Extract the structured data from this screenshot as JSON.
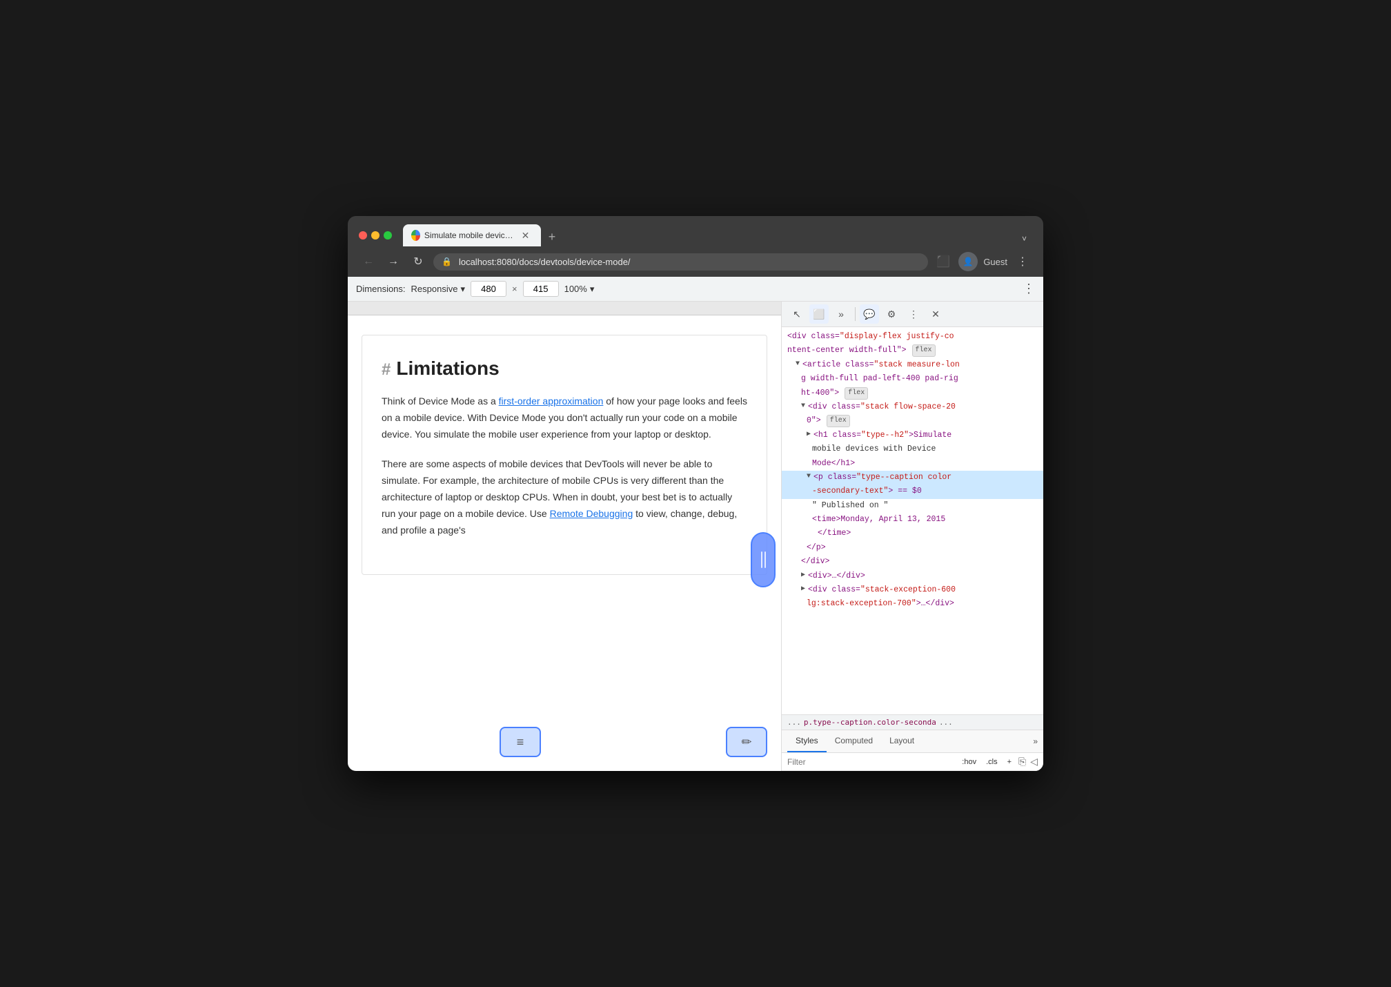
{
  "browser": {
    "tab": {
      "title": "Simulate mobile devices with D",
      "url": "localhost:8080/docs/devtools/device-mode/"
    },
    "new_tab_label": "+",
    "more_label": "˅",
    "nav": {
      "back": "←",
      "forward": "→",
      "refresh": "↻"
    },
    "profile": "Guest",
    "menu": "⋮",
    "window_icon": "⬛"
  },
  "toolbar": {
    "dimensions_label": "Dimensions: Responsive",
    "dimensions_dropdown": "▾",
    "width_value": "480",
    "height_value": "415",
    "zoom_value": "100%",
    "zoom_dropdown": "▾",
    "more_btn": "⋮"
  },
  "page": {
    "heading_hash": "#",
    "heading": "Limitations",
    "paragraphs": [
      "Think of Device Mode as a first-order approximation of how your page looks and feels on a mobile device. With Device Mode you don't actually run your code on a mobile device. You simulate the mobile user experience from your laptop or desktop.",
      "There are some aspects of mobile devices that DevTools will never be able to simulate. For example, the architecture of mobile CPUs is very different than the architecture of laptop or desktop CPUs. When in doubt, your best bet is to actually run your page on a mobile device. Use Remote Debugging to view, change, debug, and profile a page's"
    ],
    "link1": "first-order approximation",
    "link2": "Remote Debugging"
  },
  "devtools": {
    "icons": {
      "cursor": "↖",
      "device": "📱",
      "more": "»",
      "message": "🗨",
      "settings": "⚙",
      "kebab": "⋮",
      "close": "✕"
    },
    "html": {
      "lines": [
        {
          "indent": 0,
          "content": "<div class=\"display-flex justify-co",
          "suffix": "",
          "badge": "",
          "selected": false,
          "type": "tag"
        },
        {
          "indent": 0,
          "content": "ntent-center width-full\">",
          "suffix": "",
          "badge": "flex",
          "selected": false,
          "type": "tag"
        },
        {
          "indent": 1,
          "content": "<article class=\"stack measure-lon",
          "suffix": "",
          "badge": "",
          "selected": false,
          "type": "tag"
        },
        {
          "indent": 1,
          "content": "g width-full pad-left-400 pad-rig",
          "suffix": "",
          "badge": "",
          "selected": false,
          "type": "tag"
        },
        {
          "indent": 1,
          "content": "ht-400\">",
          "suffix": "",
          "badge": "flex",
          "selected": false,
          "type": "tag"
        },
        {
          "indent": 2,
          "content": "<div class=\"stack flow-space-20",
          "suffix": "",
          "badge": "",
          "selected": false,
          "type": "tag"
        },
        {
          "indent": 2,
          "content": "0\">",
          "suffix": "",
          "badge": "flex",
          "selected": false,
          "type": "tag"
        },
        {
          "indent": 3,
          "content": "<h1 class=\"type--h2\">Simulate",
          "suffix": "",
          "badge": "",
          "selected": false,
          "type": "tag"
        },
        {
          "indent": 3,
          "content": "mobile devices with Device",
          "suffix": "",
          "badge": "",
          "selected": false,
          "type": "text"
        },
        {
          "indent": 3,
          "content": "Mode</h1>",
          "suffix": "",
          "badge": "",
          "selected": false,
          "type": "tag"
        },
        {
          "indent": 3,
          "content": "<p class=\"type--caption color",
          "suffix": "",
          "badge": "",
          "selected": true,
          "type": "tag"
        },
        {
          "indent": 3,
          "content": "-secondary-text\"> == $0",
          "suffix": "",
          "badge": "",
          "selected": true,
          "type": "tag"
        },
        {
          "indent": 4,
          "content": "\" Published on \"",
          "suffix": "",
          "badge": "",
          "selected": false,
          "type": "text"
        },
        {
          "indent": 4,
          "content": "<time>Monday, April 13, 2015",
          "suffix": "",
          "badge": "",
          "selected": false,
          "type": "tag"
        },
        {
          "indent": 4,
          "content": "</time>",
          "suffix": "",
          "badge": "",
          "selected": false,
          "type": "tag"
        },
        {
          "indent": 3,
          "content": "</p>",
          "suffix": "",
          "badge": "",
          "selected": false,
          "type": "tag"
        },
        {
          "indent": 2,
          "content": "</div>",
          "suffix": "",
          "badge": "",
          "selected": false,
          "type": "tag"
        },
        {
          "indent": 2,
          "content": "<div>…</div>",
          "suffix": "",
          "badge": "",
          "selected": false,
          "type": "tag"
        },
        {
          "indent": 2,
          "content": "<div class=\"stack-exception-600",
          "suffix": "",
          "badge": "",
          "selected": false,
          "type": "tag"
        },
        {
          "indent": 2,
          "content": "lg:stack-exception-700\">…</div>",
          "suffix": "",
          "badge": "",
          "selected": false,
          "type": "tag"
        },
        {
          "indent": 0,
          "content": "...",
          "suffix": "",
          "badge": "",
          "selected": false,
          "type": "ellipsis"
        },
        {
          "indent": 1,
          "content": "p.type--caption.color-seconda",
          "suffix": "",
          "badge": "",
          "selected": false,
          "type": "breadcrumb"
        }
      ]
    },
    "breadcrumb": "... p.type--caption.color-seconda ...",
    "styles": {
      "tabs": [
        "Styles",
        "Computed",
        "Layout"
      ],
      "active_tab": "Styles",
      "filter_placeholder": "Filter",
      "filter_buttons": [
        ":hov",
        ".cls",
        "+"
      ]
    }
  }
}
